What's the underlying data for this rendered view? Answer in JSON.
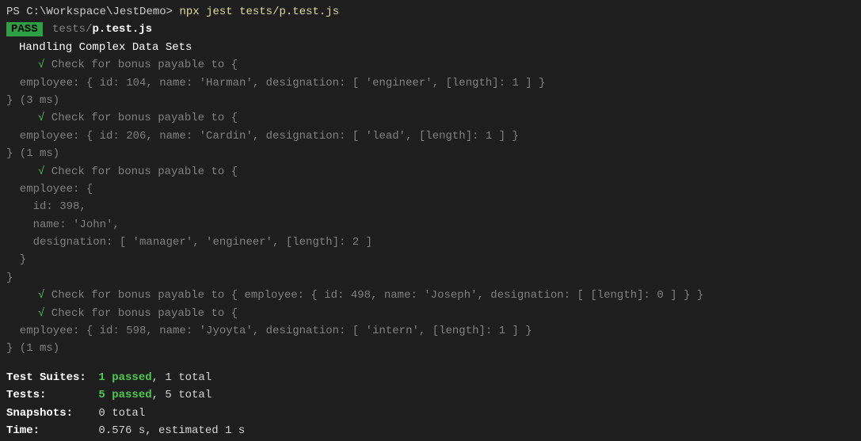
{
  "prompt": {
    "prefix": "PS ",
    "path": "C:\\Workspace\\JestDemo",
    "caret": "> ",
    "command": "npx jest tests/p.test.js"
  },
  "result_header": {
    "badge": "PASS",
    "path_dim": "tests/",
    "file_bold": "p.test.js"
  },
  "suite_title": "Handling Complex Data Sets",
  "tests": {
    "t1": {
      "check": "√",
      "line1": " Check for bonus payable to {",
      "line2": "  employee: { id: 104, name: 'Harman', designation: [ 'engineer', [length]: 1 ] }",
      "line3": "} (3 ms)"
    },
    "t2": {
      "check": "√",
      "line1": " Check for bonus payable to {",
      "line2": "  employee: { id: 206, name: 'Cardin', designation: [ 'lead', [length]: 1 ] }",
      "line3": "} (1 ms)"
    },
    "t3": {
      "check": "√",
      "line1": " Check for bonus payable to {",
      "line2": "  employee: {",
      "line3": "    id: 398,",
      "line4": "    name: 'John',",
      "line5": "    designation: [ 'manager', 'engineer', [length]: 2 ]",
      "line6": "  }",
      "line7": "}"
    },
    "t4": {
      "check": "√",
      "line1": " Check for bonus payable to { employee: { id: 498, name: 'Joseph', designation: [ [length]: 0 ] } }"
    },
    "t5": {
      "check": "√",
      "line1": " Check for bonus payable to {",
      "line2": "  employee: { id: 598, name: 'Jyoyta', designation: [ 'intern', [length]: 1 ] }",
      "line3": "} (1 ms)"
    }
  },
  "summary": {
    "suites_label": "Test Suites:",
    "suites_pass": "1 passed",
    "suites_total": ", 1 total",
    "tests_label": "Tests:",
    "tests_pass": "5 passed",
    "tests_total": ", 5 total",
    "snapshots_label": "Snapshots:",
    "snapshots_value": "0 total",
    "time_label": "Time:",
    "time_value": "0.576 s, estimated 1 s"
  }
}
